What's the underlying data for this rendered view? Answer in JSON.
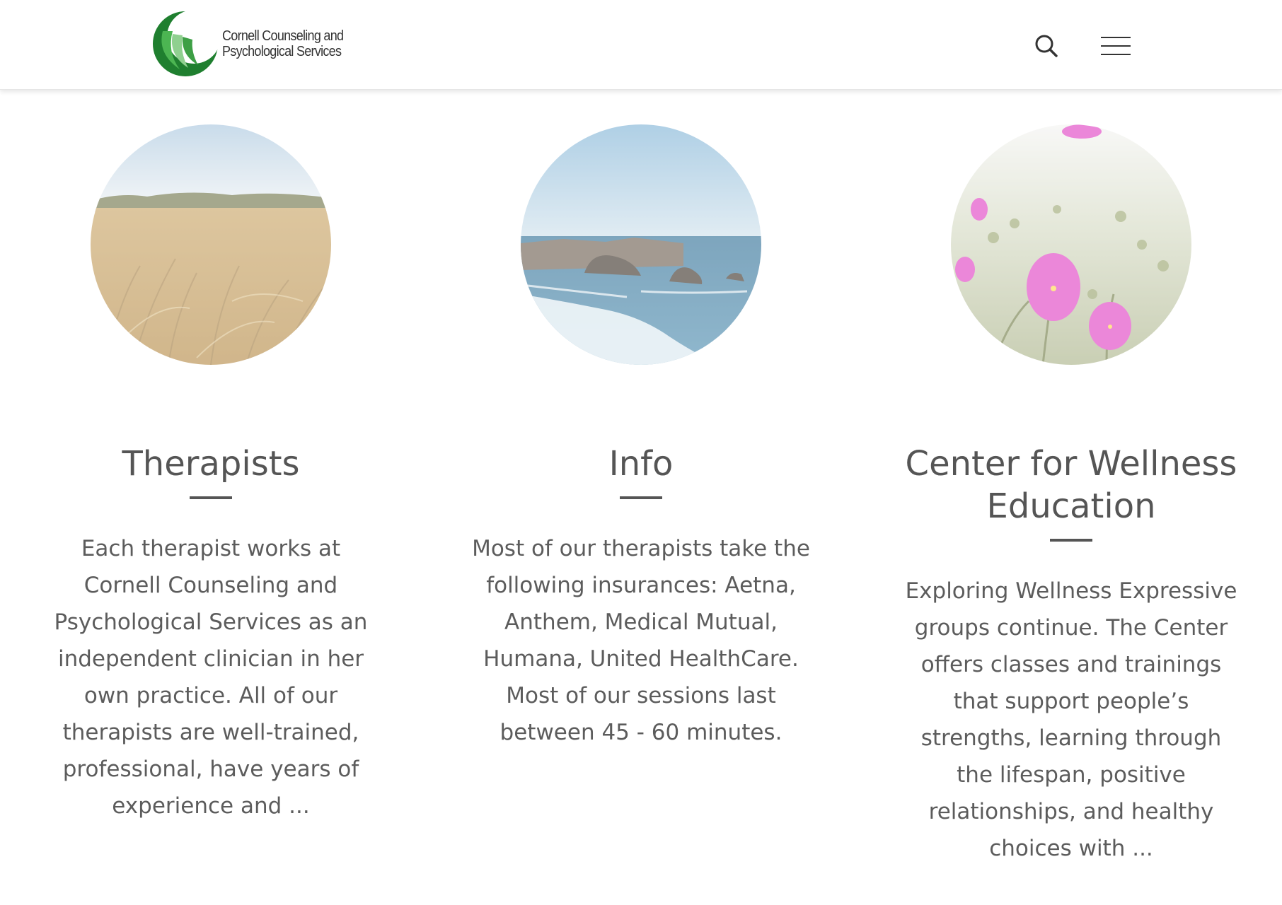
{
  "header": {
    "logo_line_1": "Cornell Counseling and",
    "logo_line_2": "Psychological Services",
    "logo_icon": "crescent-logo-icon",
    "search_icon": "search-icon",
    "menu_icon": "hamburger-menu-icon",
    "brand_color": "#2e9a3c"
  },
  "features": [
    {
      "image": "wheat-field-photo",
      "title": "Therapists",
      "text": "Each therapist works at Cornell Counseling and Psychological Services as an independent clinician in her own practice. All of our therapists are well-trained, professional, have years of experience and ..."
    },
    {
      "image": "ocean-coast-photo",
      "title": "Info",
      "text": "Most of our therapists take the following insurances: Aetna, Anthem, Medical Mutual, Humana, United HealthCare. Most of our sessions last between 45 - 60 minutes."
    },
    {
      "image": "pink-flowers-photo",
      "title": "Center for Wellness Education",
      "text": "Exploring Wellness Expressive groups continue. The Center offers classes and trainings that support people’s strengths, learning through the lifespan, positive relationships, and healthy choices with ..."
    }
  ]
}
